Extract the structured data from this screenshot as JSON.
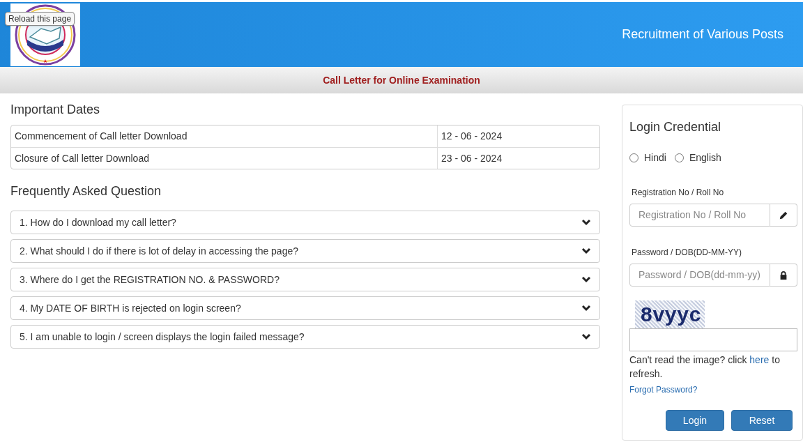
{
  "tooltip": "Reload this page",
  "header": {
    "title": "Recruitment of Various Posts"
  },
  "subheader": "Call Letter for Online Examination",
  "important_dates": {
    "heading": "Important Dates",
    "rows": [
      {
        "label": "Commencement of Call letter Download",
        "date": "12 - 06 - 2024"
      },
      {
        "label": "Closure of Call letter Download",
        "date": "23 - 06 - 2024"
      }
    ]
  },
  "faq": {
    "heading": "Frequently Asked Question",
    "items": [
      {
        "question": "1. How do I download my call letter?",
        "expanded": false
      },
      {
        "question": "2. What should I do if there is lot of delay in accessing the page?",
        "expanded": false
      },
      {
        "question": "3. Where do I get the REGISTRATION NO. & PASSWORD?",
        "expanded": false
      },
      {
        "question": "4. My DATE OF BIRTH is rejected on login screen?",
        "expanded": false
      },
      {
        "question": "5. I am unable to login / screen displays the login failed message?",
        "expanded": false
      }
    ]
  },
  "login": {
    "heading": "Login Credential",
    "languages": [
      {
        "label": "Hindi",
        "selected": false
      },
      {
        "label": "English",
        "selected": false
      }
    ],
    "fields": [
      {
        "label": "Registration No / Roll No",
        "placeholder": "Registration No / Roll No",
        "kind": "text"
      },
      {
        "label": "Password / DOB(DD-MM-YY)",
        "placeholder": "Password / DOB(dd-mm-yy)",
        "kind": "password"
      }
    ],
    "captcha": "8vyyc",
    "refresh_text": {
      "before": "Can't read the image? click",
      "link": "here",
      "after": "to refresh."
    },
    "forgot": "Forgot Password?",
    "buttons": [
      "Login",
      "Reset"
    ]
  }
}
